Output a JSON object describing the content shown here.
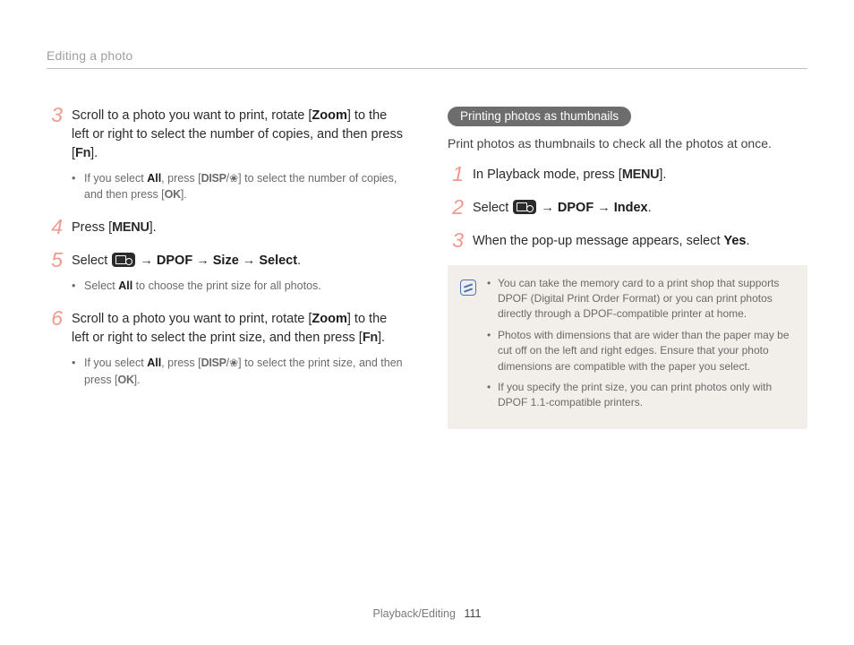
{
  "header": {
    "running": "Editing a photo"
  },
  "footer": {
    "section": "Playback/Editing",
    "page": "111"
  },
  "left": {
    "step3": {
      "num": "3",
      "pre": "Scroll to a photo you want to print, rotate [",
      "zoom": "Zoom",
      "mid": "] to the left or right to select the number of copies, and then press [",
      "fn": "Fn",
      "post": "].",
      "bullet": {
        "a": "If you select ",
        "all": "All",
        "b": ", press [",
        "disp": "DISP",
        "c": "/",
        "d": "] to select the number of copies, and then press [",
        "ok": "OK",
        "e": "]."
      }
    },
    "step4": {
      "num": "4",
      "a": "Press [",
      "menu": "MENU",
      "b": "]."
    },
    "step5": {
      "num": "5",
      "a": "Select ",
      "arrow1": " → ",
      "dpof": "DPOF",
      "arrow2": " → ",
      "size": "Size",
      "arrow3": " → ",
      "select": "Select",
      "dot": ".",
      "bullet": {
        "a": "Select ",
        "all": "All",
        "b": " to choose the print size for all photos."
      }
    },
    "step6": {
      "num": "6",
      "pre": "Scroll to a photo you want to print, rotate [",
      "zoom": "Zoom",
      "mid": "] to the left or right to select the print size, and then press [",
      "fn": "Fn",
      "post": "].",
      "bullet": {
        "a": "If you select ",
        "all": "All",
        "b": ", press [",
        "disp": "DISP",
        "c": "/",
        "d": "] to select the print size, and then press [",
        "ok": "OK",
        "e": "]."
      }
    }
  },
  "right": {
    "pill": "Printing photos as thumbnails",
    "lead": "Print photos as thumbnails to check all the photos at once.",
    "step1": {
      "num": "1",
      "a": "In Playback mode, press [",
      "menu": "MENU",
      "b": "]."
    },
    "step2": {
      "num": "2",
      "a": "Select ",
      "arrow1": " → ",
      "dpof": "DPOF",
      "arrow2": " → ",
      "index": "Index",
      "dot": "."
    },
    "step3": {
      "num": "3",
      "a": "When the pop-up message appears, select ",
      "yes": "Yes",
      "dot": "."
    },
    "notes": {
      "n1": "You can take the memory card to a print shop that supports DPOF (Digital Print Order Format) or you can print photos directly through a DPOF-compatible printer at home.",
      "n2": "Photos with dimensions that are wider than the paper may be cut off on the left and right edges. Ensure that your photo dimensions are compatible with the paper you select.",
      "n3": "If you specify the print size, you can print photos only with DPOF 1.1-compatible printers."
    }
  }
}
